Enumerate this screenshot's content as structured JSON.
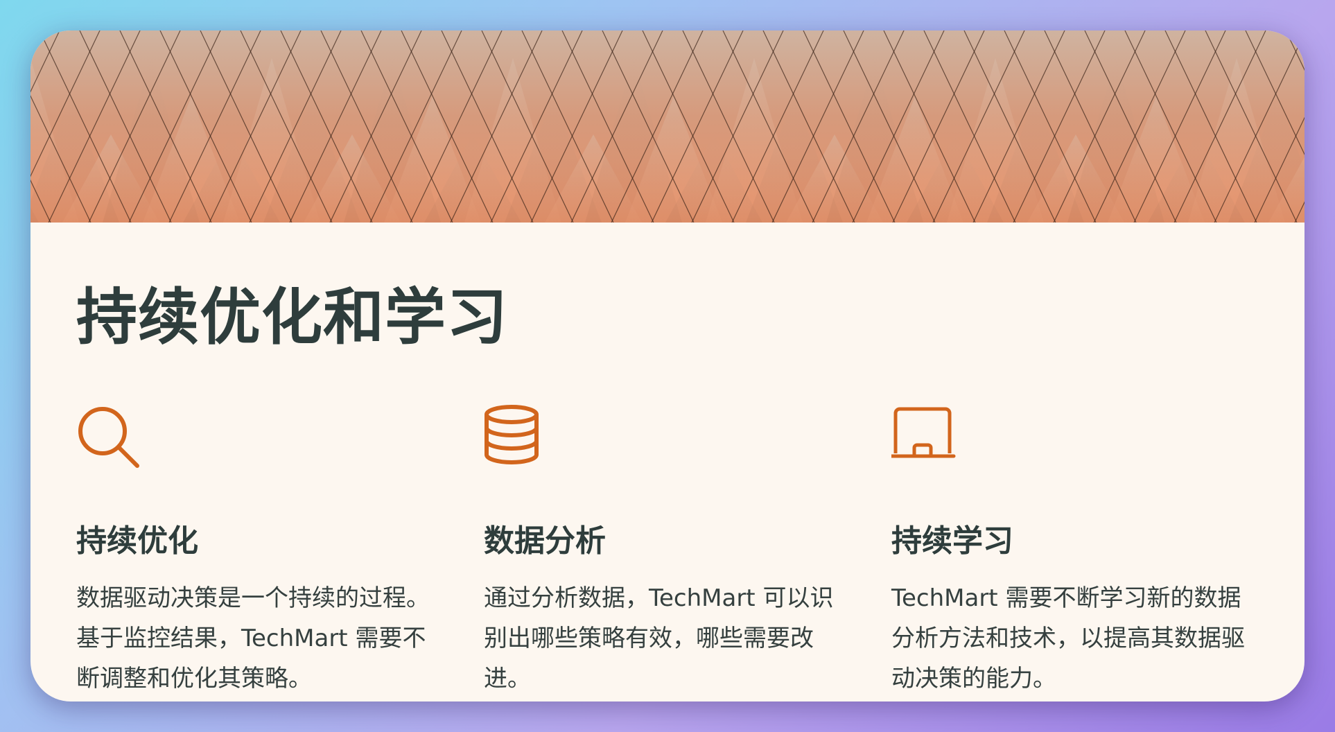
{
  "page": {
    "title": "持续优化和学习"
  },
  "features": [
    {
      "icon": "search-icon",
      "title": "持续优化",
      "description": "数据驱动决策是一个持续的过程。基于监控结果，TechMart 需要不断调整和优化其策略。"
    },
    {
      "icon": "database-icon",
      "title": "数据分析",
      "description": "通过分析数据，TechMart 可以识别出哪些策略有效，哪些需要改进。"
    },
    {
      "icon": "laptop-icon",
      "title": "持续学习",
      "description": "TechMart 需要不断学习新的数据分析方法和技术，以提高其数据驱动决策的能力。"
    }
  ],
  "colors": {
    "accent": "#d2651c",
    "card_background": "#fdf7f0",
    "heading": "#2e3d3c",
    "body_text": "#35403f",
    "banner_copper": "#e6916a"
  }
}
